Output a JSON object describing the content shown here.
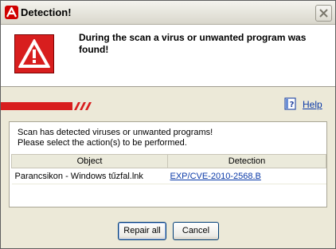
{
  "window": {
    "title": "Detection!",
    "app_icon": "avira-umbrella-icon",
    "close_icon": "close-icon"
  },
  "header": {
    "message": "During the scan a virus or unwanted program was found!",
    "icon": "warning-triangle-icon"
  },
  "help": {
    "label": "Help",
    "icon": "help-book-icon"
  },
  "panel": {
    "line1": "Scan has detected viruses or unwanted programs!",
    "line2": "Please select the action(s) to be performed.",
    "columns": [
      "Object",
      "Detection"
    ],
    "rows": [
      {
        "object": "Parancsikon - Windows tűzfal.lnk",
        "detection": "EXP/CVE-2010-2568.B"
      }
    ]
  },
  "buttons": {
    "repair": "Repair all",
    "cancel": "Cancel"
  },
  "colors": {
    "brand_red": "#d81e1e",
    "link": "#0b3aa8",
    "dialog_bg": "#ece9d8"
  }
}
